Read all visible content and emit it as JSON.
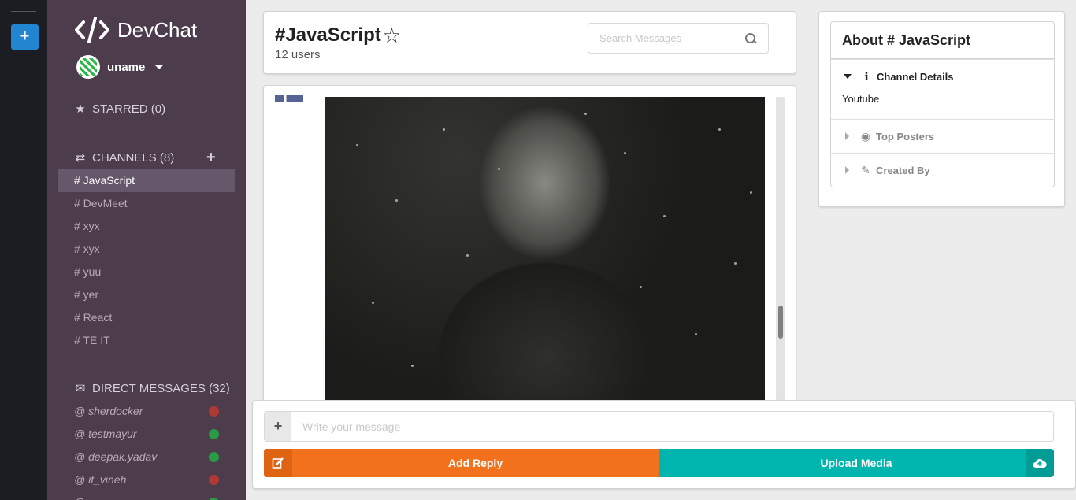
{
  "app": {
    "name": "DevChat"
  },
  "strip": {
    "add_label": "+"
  },
  "user": {
    "name": "uname"
  },
  "starred": {
    "label": "STARRED (0)"
  },
  "channels": {
    "label": "CHANNELS (8)",
    "add_label": "+",
    "items": [
      {
        "label": "# JavaScript",
        "active": true
      },
      {
        "label": "# DevMeet"
      },
      {
        "label": "# xyx"
      },
      {
        "label": "# xyx"
      },
      {
        "label": "# yuu"
      },
      {
        "label": "# yer"
      },
      {
        "label": "# React"
      },
      {
        "label": "# TE IT"
      }
    ]
  },
  "direct_messages": {
    "label": "DIRECT MESSAGES (32)",
    "items": [
      {
        "label": "@ sherdocker",
        "status": "offline",
        "color": "#db2828"
      },
      {
        "label": "@ testmayur",
        "status": "online",
        "color": "#21ba45"
      },
      {
        "label": "@ deepak.yadav",
        "status": "online",
        "color": "#21ba45"
      },
      {
        "label": "@ it_vineh",
        "status": "offline",
        "color": "#db2828"
      },
      {
        "label": "@ ",
        "status": "online",
        "color": "#21ba45"
      }
    ]
  },
  "header": {
    "channel_title": "#JavaScript",
    "star_icon": "☆",
    "users_count": "12 users",
    "search_placeholder": "Search Messages"
  },
  "message_form": {
    "placeholder": "Write your message",
    "reply_label": "Add Reply",
    "upload_label": "Upload Media"
  },
  "about": {
    "title": "About # JavaScript",
    "sections": [
      {
        "title": "Channel Details",
        "icon": "info-icon",
        "open": true,
        "content": "Youtube"
      },
      {
        "title": "Top Posters",
        "icon": "user-circle-icon",
        "open": false
      },
      {
        "title": "Created By",
        "icon": "pencil-icon",
        "open": false
      }
    ]
  },
  "colors": {
    "sidebar": "#4c3c4c",
    "strip": "#1c1d22",
    "primary": "#2185d0",
    "orange": "#f2711c",
    "teal": "#00b5ad",
    "online": "#21ba45",
    "offline": "#db2828"
  }
}
